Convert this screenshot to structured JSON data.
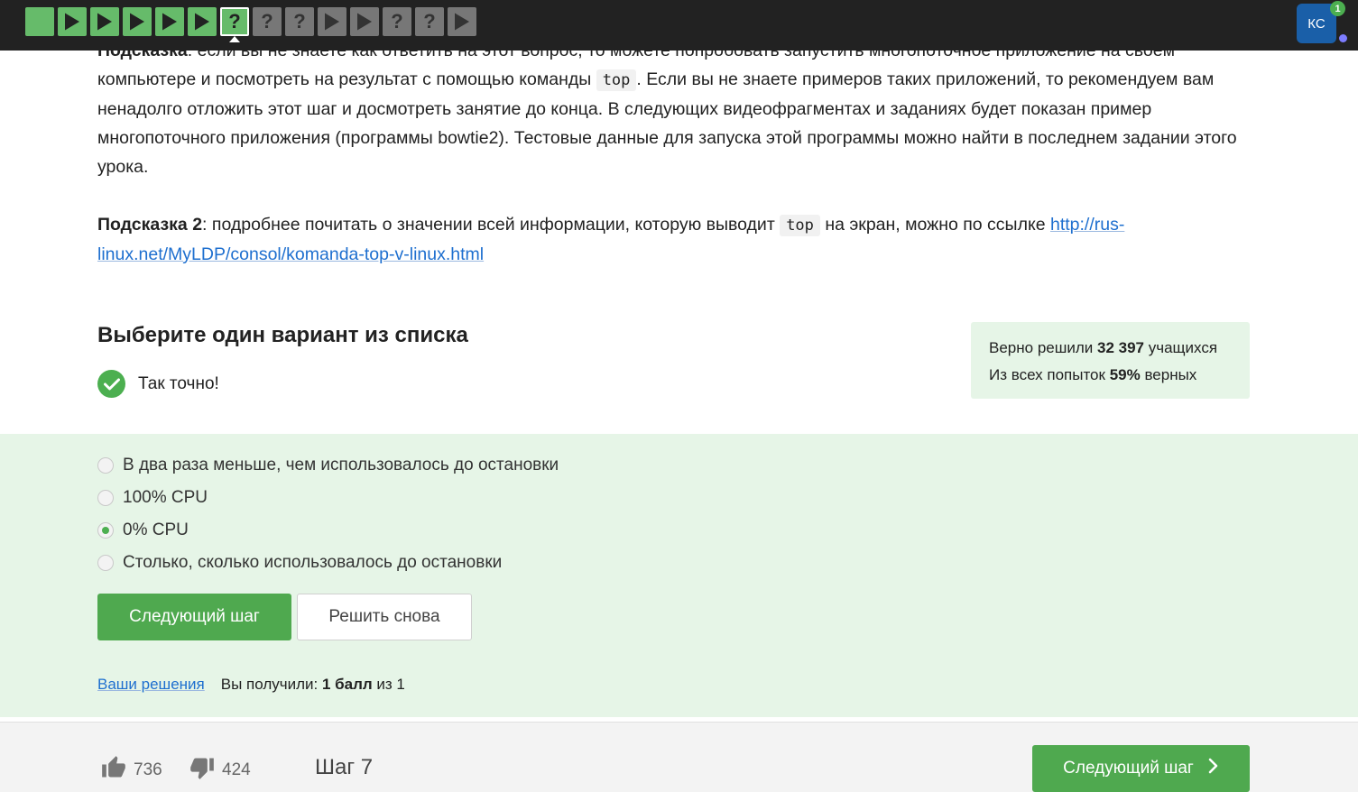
{
  "progress": {
    "steps": [
      {
        "type": "plain",
        "state": "done"
      },
      {
        "type": "video",
        "state": "done"
      },
      {
        "type": "video",
        "state": "done"
      },
      {
        "type": "video",
        "state": "done"
      },
      {
        "type": "video",
        "state": "done"
      },
      {
        "type": "video",
        "state": "done"
      },
      {
        "type": "question",
        "state": "current",
        "label": "?"
      },
      {
        "type": "question",
        "state": "todo",
        "label": "?"
      },
      {
        "type": "question",
        "state": "todo",
        "label": "?"
      },
      {
        "type": "video",
        "state": "todo"
      },
      {
        "type": "video",
        "state": "todo"
      },
      {
        "type": "question",
        "state": "todo",
        "label": "?"
      },
      {
        "type": "question",
        "state": "todo",
        "label": "?"
      },
      {
        "type": "video",
        "state": "todo"
      }
    ]
  },
  "user": {
    "initials": "КС",
    "notifications": "1"
  },
  "content": {
    "hint1_label": "Подсказка",
    "hint1_text_a": ": если вы не знаете как ответить на этот вопрос, то можете попробовать запустить многопоточное приложение на своем компьютере и посмотреть на результат с помощью команды ",
    "hint1_code": "top",
    "hint1_text_b": ". Если вы не знаете примеров таких приложений, то рекомендуем вам ненадолго отложить этот шаг и досмотреть занятие до конца. В следующих видеофрагментах и заданиях будет показан пример многопоточного приложения (программы bowtie2). Тестовые данные для запуска этой программы можно найти в последнем задании этого урока.",
    "hint2_label": "Подсказка 2",
    "hint2_text_a": ": подробнее почитать о значении всей информации, которую выводит ",
    "hint2_code": "top",
    "hint2_text_b": " на экран, можно по ссылке ",
    "hint2_link": "http://rus-linux.net/MyLDP/consol/komanda-top-v-linux.html"
  },
  "quiz": {
    "title": "Выберите один вариант из списка",
    "result": "Так точно!",
    "stats": {
      "solved_prefix": "Верно решили ",
      "solved_count": "32 397",
      "solved_suffix": " учащихся",
      "attempts_prefix": "Из всех попыток ",
      "attempts_percent": "59%",
      "attempts_suffix": " верных"
    },
    "options": [
      {
        "label": "В два раза меньше, чем использовалось до остановки",
        "selected": false
      },
      {
        "label": "100% CPU",
        "selected": false
      },
      {
        "label": "0% CPU",
        "selected": true
      },
      {
        "label": "Столько, сколько использовалось до остановки",
        "selected": false
      }
    ],
    "next_button": "Следующий шаг",
    "retry_button": "Решить снова",
    "solutions_link": "Ваши решения",
    "score_prefix": "Вы получили: ",
    "score_bold": "1 балл",
    "score_suffix": " из 1"
  },
  "footer": {
    "likes": "736",
    "dislikes": "424",
    "step_label": "Шаг 7",
    "next_button": "Следующий шаг"
  }
}
